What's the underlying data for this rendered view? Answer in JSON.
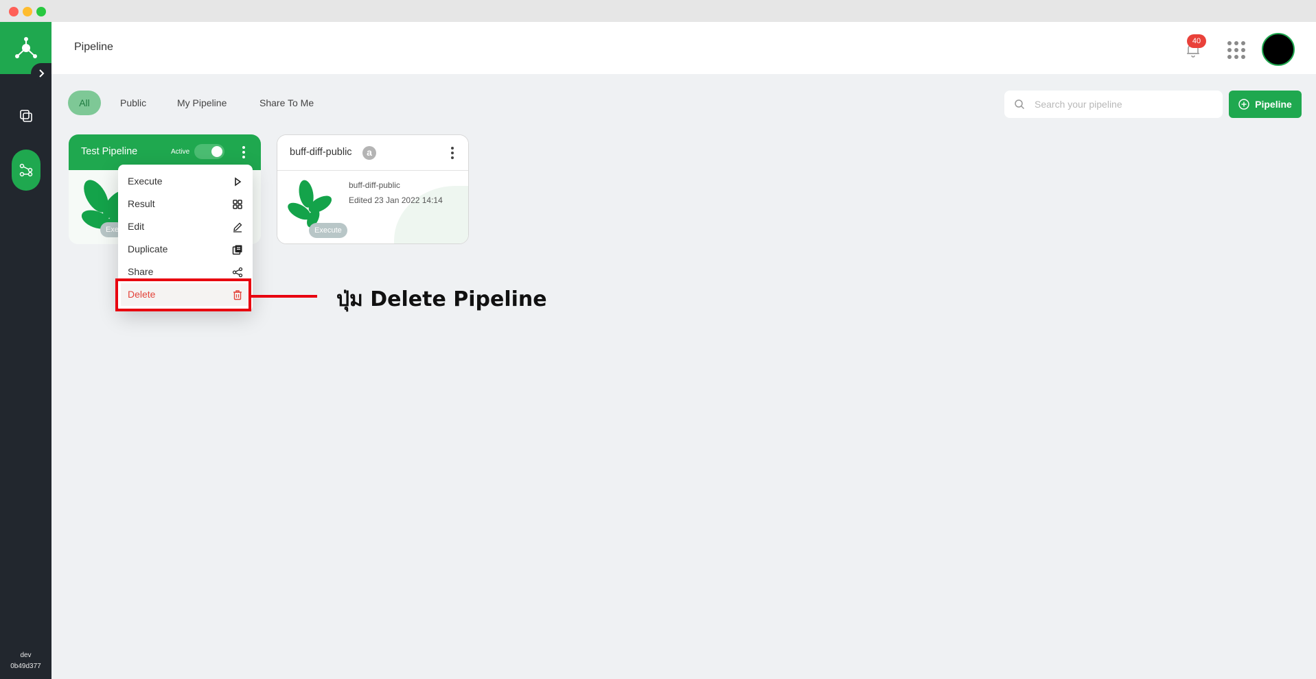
{
  "header": {
    "title": "Pipeline",
    "notification_count": "40"
  },
  "sidebar": {
    "env": "dev",
    "version": "0b49d377"
  },
  "filters": {
    "tabs": [
      {
        "label": "All",
        "active": true
      },
      {
        "label": "Public",
        "active": false
      },
      {
        "label": "My Pipeline",
        "active": false
      },
      {
        "label": "Share To Me",
        "active": false
      }
    ]
  },
  "search": {
    "placeholder": "Search your pipeline",
    "value": ""
  },
  "new_button": {
    "label": "Pipeline"
  },
  "cards": [
    {
      "title": "Test Pipeline",
      "status_label": "Active",
      "active": true,
      "execute_label": "Exe"
    },
    {
      "title": "buff-diff-public",
      "public_mark": "a",
      "description": "buff-diff-public",
      "edited": "Edited 23 Jan 2022 14:14",
      "execute_label": "Execute"
    }
  ],
  "menu": {
    "items": [
      {
        "label": "Execute",
        "icon": "play-icon"
      },
      {
        "label": "Result",
        "icon": "grid-icon"
      },
      {
        "label": "Edit",
        "icon": "pencil-icon"
      },
      {
        "label": "Duplicate",
        "icon": "duplicate-icon"
      },
      {
        "label": "Share",
        "icon": "share-icon"
      },
      {
        "label": "Delete",
        "icon": "trash-icon"
      }
    ]
  },
  "annotation": {
    "text": "ปุ่ม Delete Pipeline"
  },
  "colors": {
    "brand_green": "#1fa84f",
    "sidebar_dark": "#22272e",
    "danger": "#e3433a",
    "highlight": "#e8000f"
  }
}
